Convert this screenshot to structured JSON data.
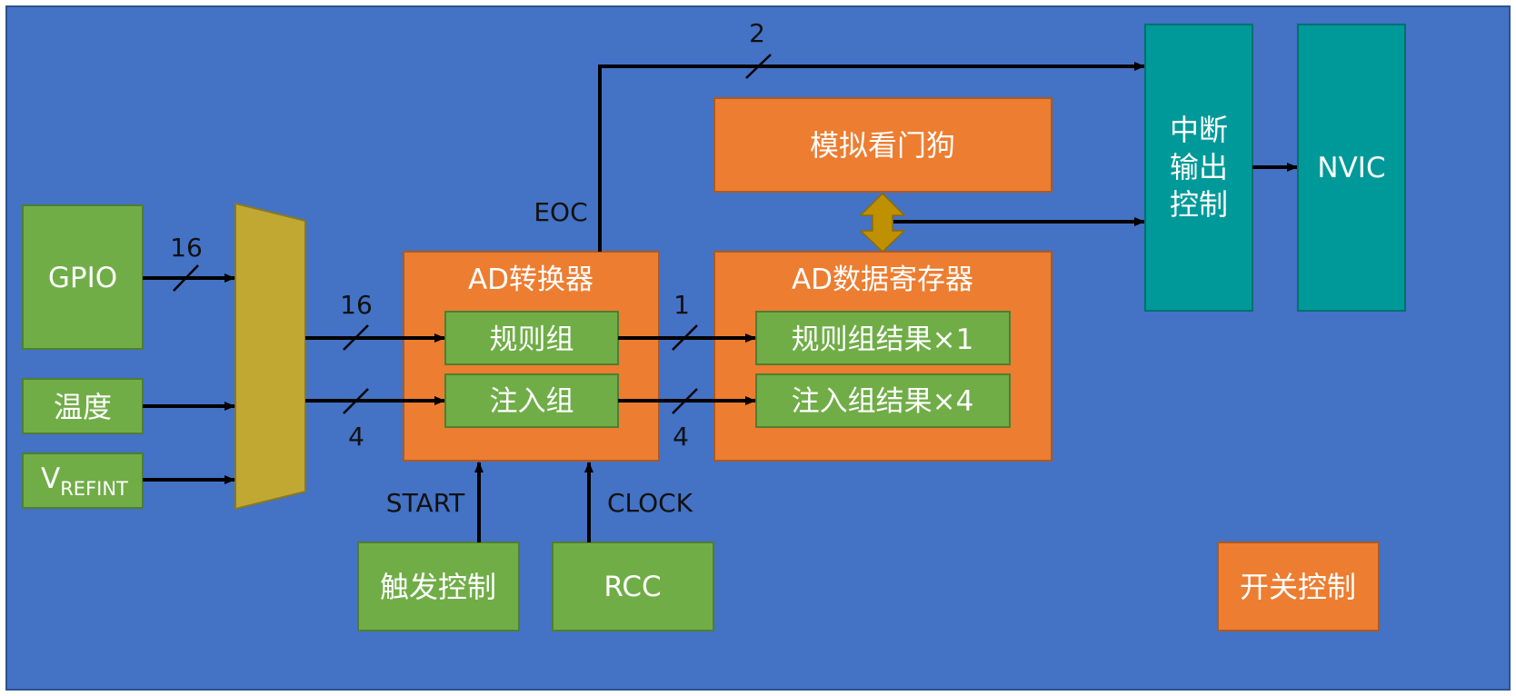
{
  "colors": {
    "background": "#4472C4",
    "green": "#70AD47",
    "orange": "#ED7D31",
    "teal": "#009999",
    "mux": "#C0A832",
    "watchdog_arrow": "#BF9000",
    "line": "#000000",
    "text_light": "#FFFFFF",
    "text_dark": "#111111"
  },
  "inputs": {
    "gpio": "GPIO",
    "temperature": "温度",
    "vrefint_main": "V",
    "vrefint_sub": "REFINT"
  },
  "converter": {
    "title": "AD转换器",
    "regular": "规则组",
    "injected": "注入组"
  },
  "register": {
    "title": "AD数据寄存器",
    "regular_result": "规则组结果×1",
    "injected_result": "注入组结果×4"
  },
  "watchdog": "模拟看门狗",
  "interrupt": [
    "中断",
    "输出",
    "控制"
  ],
  "nvic": "NVIC",
  "trigger": "触发控制",
  "rcc": "RCC",
  "power": "开关控制",
  "signals": {
    "eoc": "EOC",
    "start": "START",
    "clock": "CLOCK"
  },
  "bus_widths": {
    "gpio_bus": "16",
    "regular_in": "16",
    "injected_in": "4",
    "regular_out": "1",
    "injected_out": "4",
    "eoc_bus": "2"
  }
}
